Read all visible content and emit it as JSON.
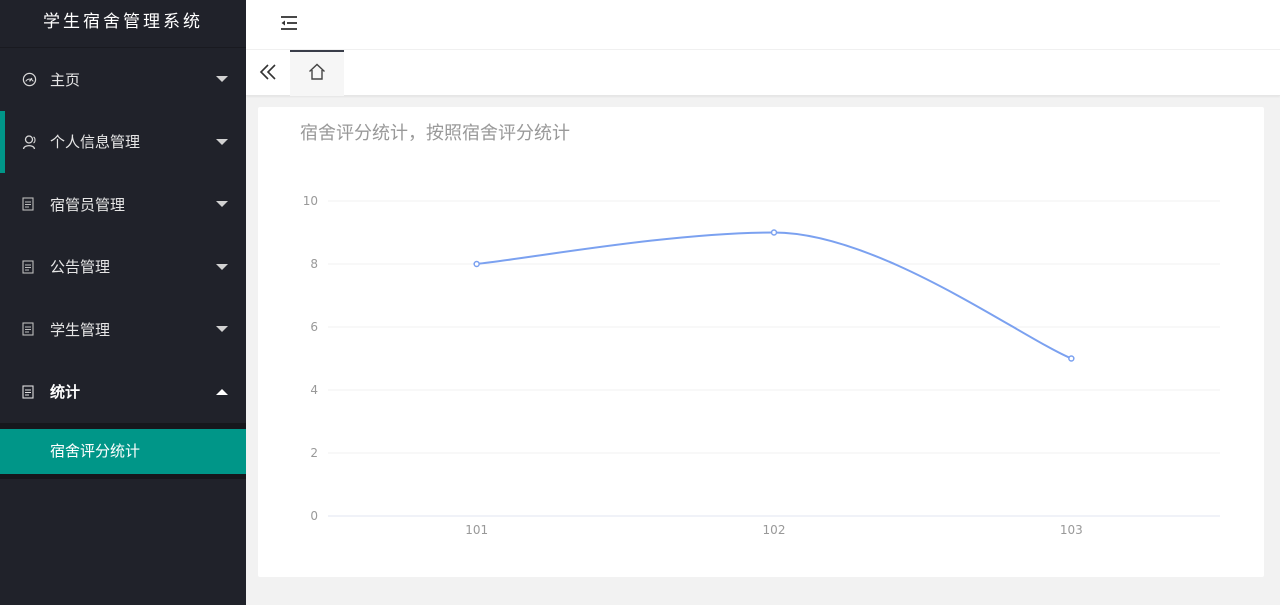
{
  "app": {
    "title": "学生宿舍管理系统"
  },
  "sidebar": {
    "items": [
      {
        "label": "主页",
        "icon": "dashboard-icon",
        "expanded": false
      },
      {
        "label": "个人信息管理",
        "icon": "user-icon",
        "expanded": false
      },
      {
        "label": "宿管员管理",
        "icon": "file-icon",
        "expanded": false
      },
      {
        "label": "公告管理",
        "icon": "file-icon",
        "expanded": false
      },
      {
        "label": "学生管理",
        "icon": "file-icon",
        "expanded": false
      },
      {
        "label": "统计",
        "icon": "file-icon",
        "expanded": true
      }
    ],
    "submenu": [
      {
        "label": "宿舍评分统计",
        "selected": true
      }
    ]
  },
  "header": {
    "flexible_icon": "indent-icon"
  },
  "tabs": {
    "prev_icon": "double-chevron-left-icon",
    "home_icon": "home-icon"
  },
  "colors": {
    "sidebar_bg": "#20222a",
    "accent": "#009688",
    "line": "#7ba1f0"
  },
  "chart_data": {
    "type": "line",
    "title": "宿舍评分统计，按照宿舍评分统计",
    "categories": [
      "101",
      "102",
      "103"
    ],
    "series": [
      {
        "values": [
          8,
          9,
          5
        ]
      }
    ],
    "ylim": [
      0,
      10
    ],
    "yticks": [
      0,
      2,
      4,
      6,
      8,
      10
    ],
    "smooth": true,
    "grid": true
  }
}
